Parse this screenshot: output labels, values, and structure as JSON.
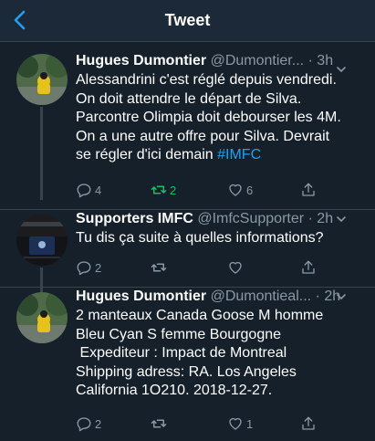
{
  "header": {
    "title": "Tweet"
  },
  "tweets": [
    {
      "name": "Hugues Dumontier",
      "handle": "@Dumontier...",
      "time": "· 3h",
      "text_lines": [
        "Alessandrini c'est réglé depuis vendredi.",
        "On doit attendre le  départ de Silva.",
        "Parcontre Olimpia doit debourser les 4M.",
        "On a une autre  offre pour Silva. Devrait",
        "se régler d'ici demain "
      ],
      "hashtag": "#IMFC",
      "replies": "4",
      "retweets": "2",
      "likes": "6"
    },
    {
      "name": "Supporters IMFC",
      "handle": "@ImfcSupporter",
      "time": "· 2h",
      "text_lines": [
        "Tu dis ça suite à quelles informations?"
      ],
      "replies": "2",
      "retweets": "",
      "likes": ""
    },
    {
      "name": "Hugues Dumontier",
      "handle": "@Dumontieal...",
      "time": "· 2h",
      "text_lines": [
        "2 manteaux Canada Goose M homme",
        "Bleu Cyan S femme Bourgogne",
        " Expediteur : Impact de Montreal",
        "Shipping adress:  RA. Los Angeles",
        "California 1O210. 2018-12-27."
      ],
      "replies": "2",
      "retweets": "",
      "likes": "1"
    }
  ],
  "colors": {
    "background": "#15202b",
    "topbar": "#1c2938",
    "accent": "#1da1f2",
    "muted": "#8899a6",
    "retweet_active": "#17bf63",
    "divider": "#38444d"
  },
  "icons": [
    "back-chevron-icon",
    "reply-icon",
    "retweet-icon",
    "like-icon",
    "share-icon",
    "more-chevron-icon"
  ]
}
